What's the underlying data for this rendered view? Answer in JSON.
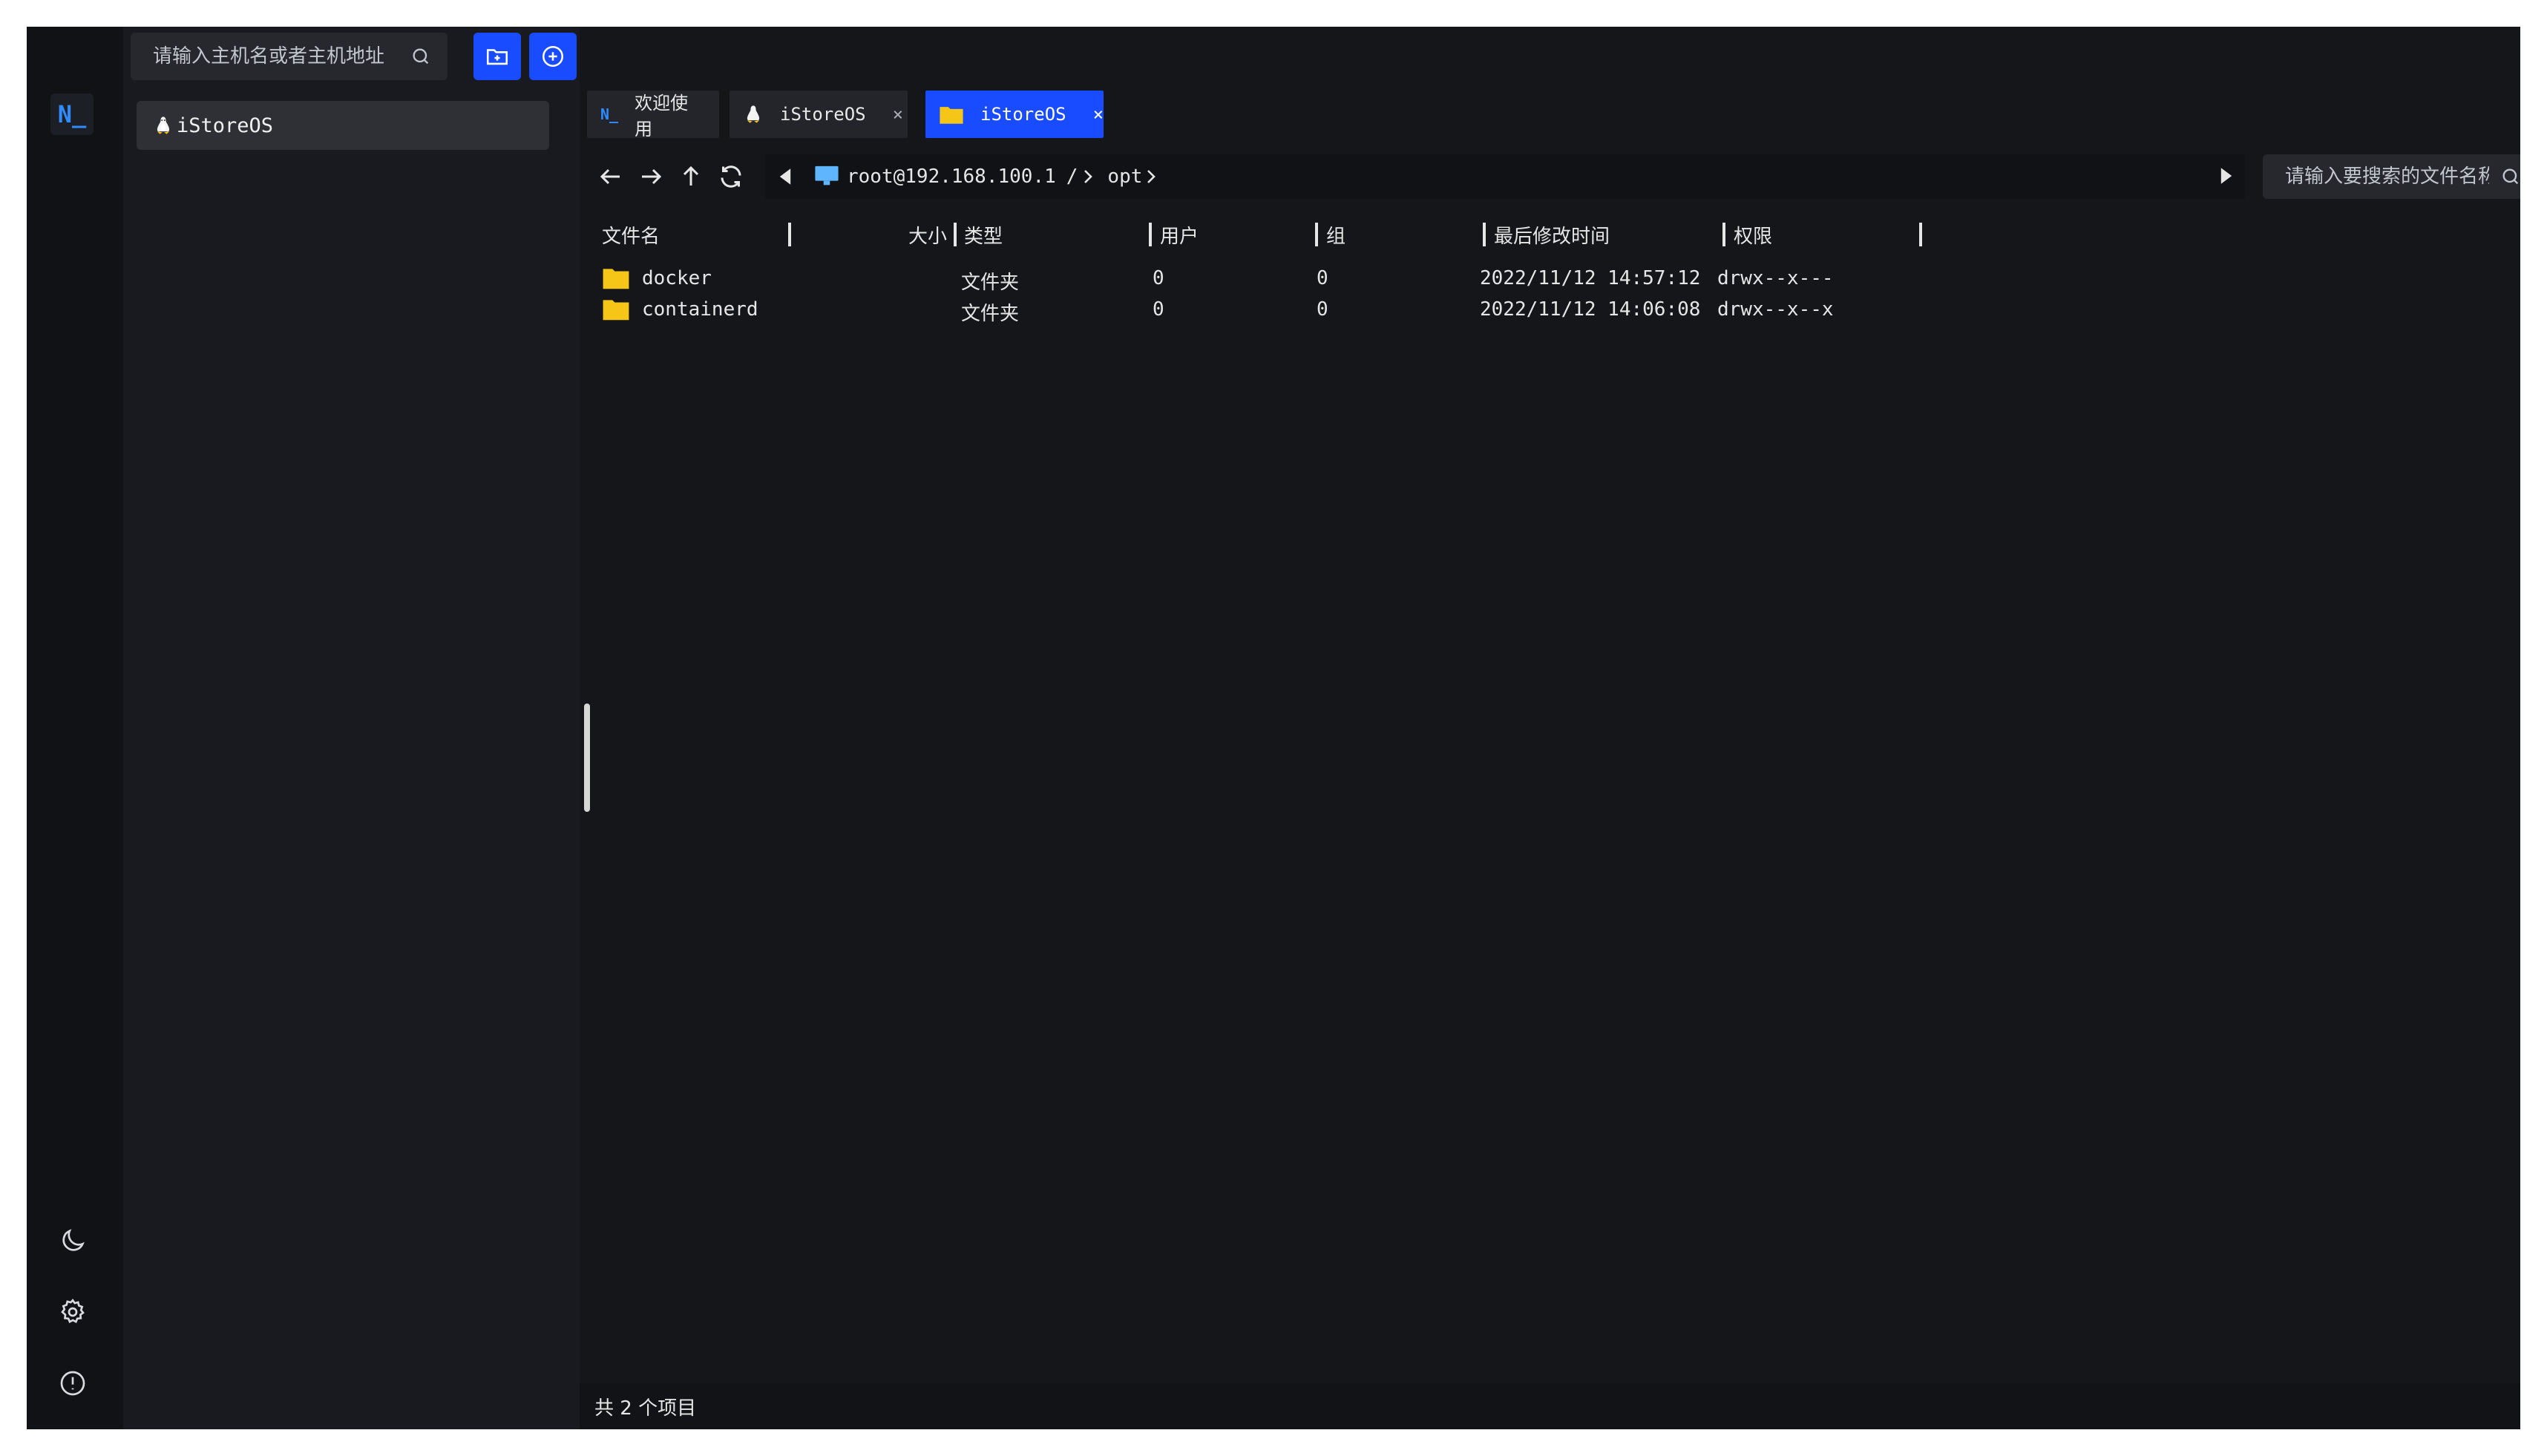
{
  "host_panel": {
    "search_placeholder": "请输入主机名或者主机地址",
    "hosts": [
      {
        "label": "iStoreOS"
      }
    ]
  },
  "rail": {
    "logo": "N_"
  },
  "tabs": [
    {
      "label": "欢迎使用",
      "icon": "app-logo-icon",
      "closable": false
    },
    {
      "label": "iStoreOS",
      "icon": "linux-tux-icon",
      "closable": true
    },
    {
      "label": "iStoreOS",
      "icon": "folder-icon",
      "closable": true,
      "active": true
    }
  ],
  "close_glyph": "×",
  "path": {
    "host": "root@192.168.100.1",
    "root_sep": "/",
    "segments": [
      "opt"
    ]
  },
  "file_search": {
    "placeholder": "请输入要搜索的文件名称"
  },
  "columns": {
    "name": "文件名",
    "size": "大小",
    "type": "类型",
    "user": "用户",
    "group": "组",
    "mtime": "最后修改时间",
    "perm": "权限"
  },
  "files": [
    {
      "name": "docker",
      "size": "",
      "type": "文件夹",
      "user": "0",
      "group": "0",
      "mtime": "2022/11/12 14:57:12",
      "perm": "drwx--x---"
    },
    {
      "name": "containerd",
      "size": "",
      "type": "文件夹",
      "user": "0",
      "group": "0",
      "mtime": "2022/11/12 14:06:08",
      "perm": "drwx--x--x"
    }
  ],
  "status": {
    "text": "共 2 个项目"
  },
  "colors": {
    "accent": "#1a4cff",
    "folder": "#f5c518",
    "background": "#15161a"
  }
}
